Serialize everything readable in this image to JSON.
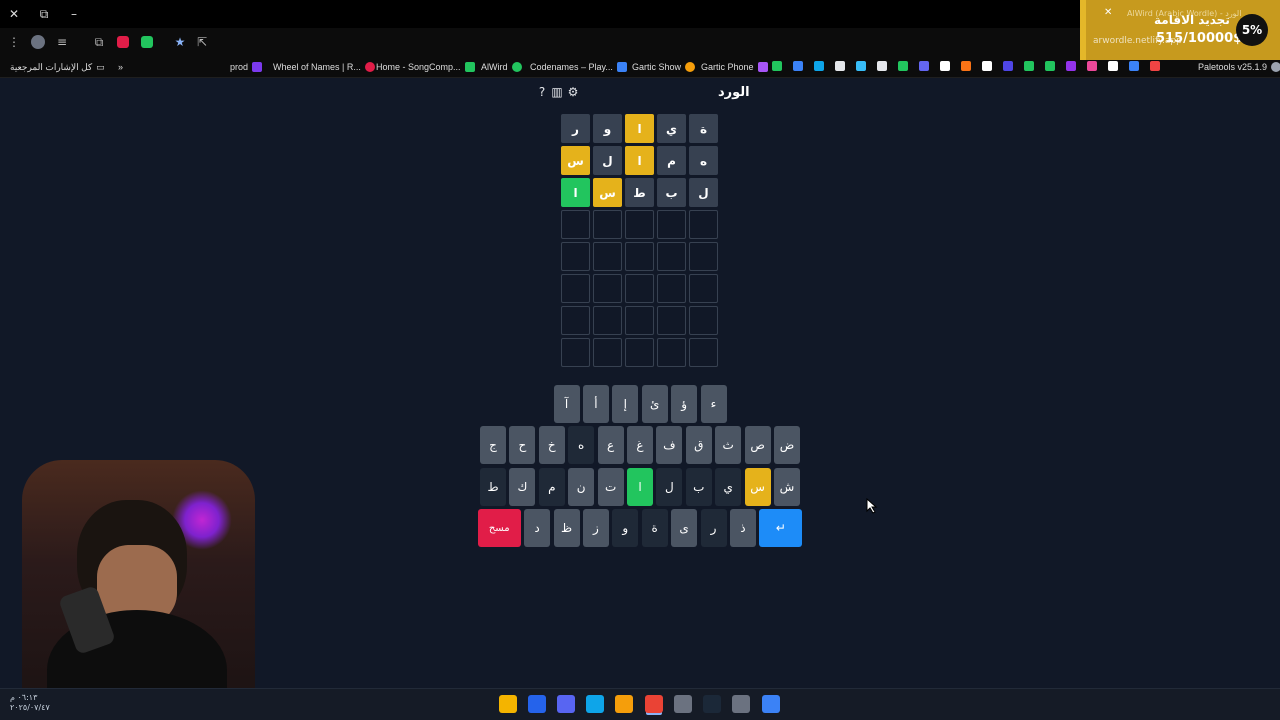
{
  "browser": {
    "window_controls": [
      "✕",
      "⧉",
      "–"
    ],
    "bookmarks_all_label": "كل الإشارات المرجعية",
    "bookmarks": [
      {
        "label": "prod",
        "color": "#7c3aed"
      },
      {
        "label": "Wheel of Names | R...",
        "color": "#e11d48"
      },
      {
        "label": "Home - SongComp...",
        "color": "#22c55e"
      },
      {
        "label": "AlWird",
        "color": "#22c55e"
      },
      {
        "label": "Codenames – Play...",
        "color": "#3b82f6"
      },
      {
        "label": "Gartic Show",
        "color": "#f59e0b"
      },
      {
        "label": "Gartic Phone",
        "color": "#a855f7"
      },
      {
        "label": "Paletools v25.1.9",
        "color": "#9ca3af"
      }
    ],
    "extra_bookmark_icon_colors": [
      "#22c55e",
      "#3b82f6",
      "#0ea5e9",
      "#e5e7eb",
      "#38bdf8",
      "#e5e7eb",
      "#22c55e",
      "#6366f1",
      "#fff",
      "#f97316",
      "#fff",
      "#4f46e5",
      "#22c55e",
      "#22c55e",
      "#9333ea",
      "#ec4899",
      "#fff",
      "#3b82f6",
      "#ef4444"
    ]
  },
  "notification": {
    "site_title": "AlWird (Arabic Wordle) - الورد",
    "headline": "تجديد الاقامة",
    "url": "arwordle.netlify.app",
    "amount": "515/10000$",
    "percent": "5%",
    "close": "✕"
  },
  "game": {
    "title": "الورد",
    "icons": [
      "help-icon",
      "stats-icon",
      "settings-icon"
    ],
    "board": [
      [
        {
          "l": "ة",
          "s": "gray"
        },
        {
          "l": "ي",
          "s": "gray"
        },
        {
          "l": "ا",
          "s": "yellow"
        },
        {
          "l": "و",
          "s": "gray"
        },
        {
          "l": "ر",
          "s": "gray"
        }
      ],
      [
        {
          "l": "ه",
          "s": "gray"
        },
        {
          "l": "م",
          "s": "gray"
        },
        {
          "l": "ا",
          "s": "yellow"
        },
        {
          "l": "ل",
          "s": "gray"
        },
        {
          "l": "س",
          "s": "yellow"
        }
      ],
      [
        {
          "l": "ل",
          "s": "gray"
        },
        {
          "l": "ب",
          "s": "gray"
        },
        {
          "l": "ط",
          "s": "gray"
        },
        {
          "l": "س",
          "s": "yellow"
        },
        {
          "l": "ا",
          "s": "green"
        }
      ],
      [
        {
          "l": "",
          "s": "empty"
        },
        {
          "l": "",
          "s": "empty"
        },
        {
          "l": "",
          "s": "empty"
        },
        {
          "l": "",
          "s": "empty"
        },
        {
          "l": "",
          "s": "empty"
        }
      ],
      [
        {
          "l": "",
          "s": "empty"
        },
        {
          "l": "",
          "s": "empty"
        },
        {
          "l": "",
          "s": "empty"
        },
        {
          "l": "",
          "s": "empty"
        },
        {
          "l": "",
          "s": "empty"
        }
      ],
      [
        {
          "l": "",
          "s": "empty"
        },
        {
          "l": "",
          "s": "empty"
        },
        {
          "l": "",
          "s": "empty"
        },
        {
          "l": "",
          "s": "empty"
        },
        {
          "l": "",
          "s": "empty"
        }
      ],
      [
        {
          "l": "",
          "s": "empty"
        },
        {
          "l": "",
          "s": "empty"
        },
        {
          "l": "",
          "s": "empty"
        },
        {
          "l": "",
          "s": "empty"
        },
        {
          "l": "",
          "s": "empty"
        }
      ],
      [
        {
          "l": "",
          "s": "empty"
        },
        {
          "l": "",
          "s": "empty"
        },
        {
          "l": "",
          "s": "empty"
        },
        {
          "l": "",
          "s": "empty"
        },
        {
          "l": "",
          "s": "empty"
        }
      ]
    ],
    "keyboard": [
      [
        {
          "l": "ء",
          "s": "normal"
        },
        {
          "l": "ؤ",
          "s": "normal"
        },
        {
          "l": "ئ",
          "s": "normal"
        },
        {
          "l": "إ",
          "s": "normal"
        },
        {
          "l": "أ",
          "s": "normal"
        },
        {
          "l": "آ",
          "s": "normal"
        }
      ],
      [
        {
          "l": "ض",
          "s": "normal"
        },
        {
          "l": "ص",
          "s": "normal"
        },
        {
          "l": "ث",
          "s": "normal"
        },
        {
          "l": "ق",
          "s": "normal"
        },
        {
          "l": "ف",
          "s": "normal"
        },
        {
          "l": "غ",
          "s": "normal"
        },
        {
          "l": "ع",
          "s": "normal"
        },
        {
          "l": "ه",
          "s": "dark"
        },
        {
          "l": "خ",
          "s": "normal"
        },
        {
          "l": "ح",
          "s": "normal"
        },
        {
          "l": "ج",
          "s": "normal"
        }
      ],
      [
        {
          "l": "ش",
          "s": "normal"
        },
        {
          "l": "س",
          "s": "yellow"
        },
        {
          "l": "ي",
          "s": "dark"
        },
        {
          "l": "ب",
          "s": "dark"
        },
        {
          "l": "ل",
          "s": "dark"
        },
        {
          "l": "ا",
          "s": "green"
        },
        {
          "l": "ت",
          "s": "normal"
        },
        {
          "l": "ن",
          "s": "normal"
        },
        {
          "l": "م",
          "s": "dark"
        },
        {
          "l": "ك",
          "s": "normal"
        },
        {
          "l": "ط",
          "s": "dark"
        }
      ],
      [
        {
          "l": "↵",
          "s": "enter"
        },
        {
          "l": "ذ",
          "s": "normal"
        },
        {
          "l": "ر",
          "s": "dark"
        },
        {
          "l": "ى",
          "s": "normal"
        },
        {
          "l": "ة",
          "s": "dark"
        },
        {
          "l": "و",
          "s": "dark"
        },
        {
          "l": "ز",
          "s": "normal"
        },
        {
          "l": "ظ",
          "s": "normal"
        },
        {
          "l": "د",
          "s": "normal"
        },
        {
          "l": "مسح",
          "s": "del"
        }
      ]
    ]
  },
  "taskbar": {
    "clock_time": "٠٦:١٣ م",
    "clock_date": "٢٠٢٥/٠٧/٤٧",
    "app_icons": [
      {
        "name": "rockstar-icon",
        "color": "#f4b400"
      },
      {
        "name": "edge-dev-icon",
        "color": "#2563eb"
      },
      {
        "name": "discord-icon",
        "color": "#5865f2"
      },
      {
        "name": "edge-icon",
        "color": "#0ea5e9"
      },
      {
        "name": "file-explorer-icon",
        "color": "#f59e0b"
      },
      {
        "name": "chrome-icon",
        "color": "#ea4335"
      },
      {
        "name": "obs-icon",
        "color": "#6b7280"
      },
      {
        "name": "steam-icon",
        "color": "#1b2838"
      },
      {
        "name": "settings-icon",
        "color": "#6b7280"
      },
      {
        "name": "start-icon",
        "color": "#3b82f6"
      }
    ]
  }
}
